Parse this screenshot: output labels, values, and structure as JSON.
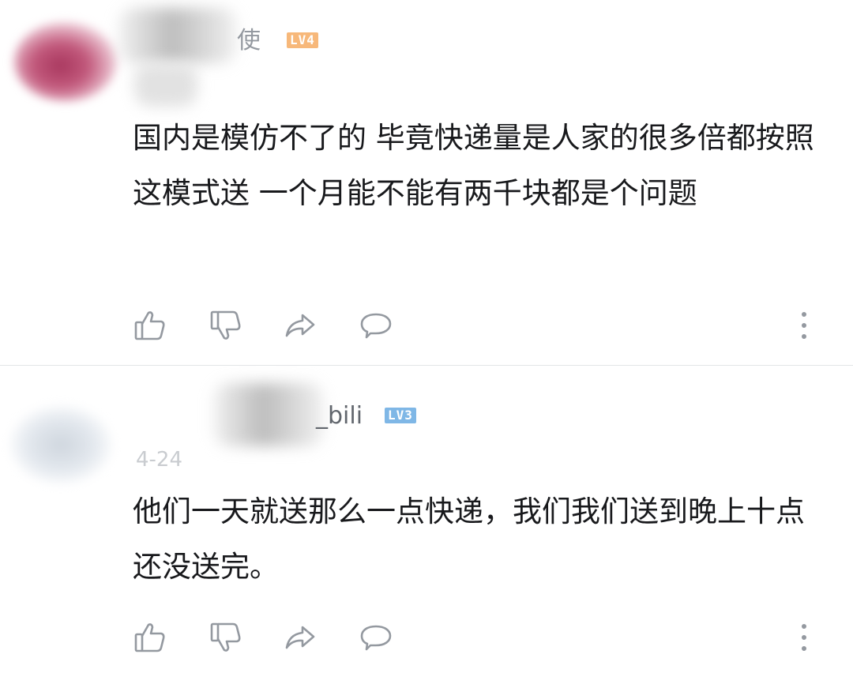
{
  "comments": [
    {
      "username": "使",
      "level": "LV4",
      "date": "",
      "text": "国内是模仿不了的 毕竟快递量是人家的很多倍都按照这模式送 一个月能不能有两千块都是个问题"
    },
    {
      "username": "_bili",
      "level": "LV3",
      "date": "4-24",
      "text": "他们一天就送那么一点快递，我们我们送到晚上十点还没送完。"
    }
  ],
  "icons": [
    "like-icon",
    "dislike-icon",
    "share-icon",
    "reply-icon",
    "more-icon"
  ],
  "colors": {
    "text": "#18191c",
    "icon": "#9499a0",
    "lv4": "#f7b87a",
    "lv3": "#7fb7e6",
    "divider": "#e3e5e7"
  }
}
